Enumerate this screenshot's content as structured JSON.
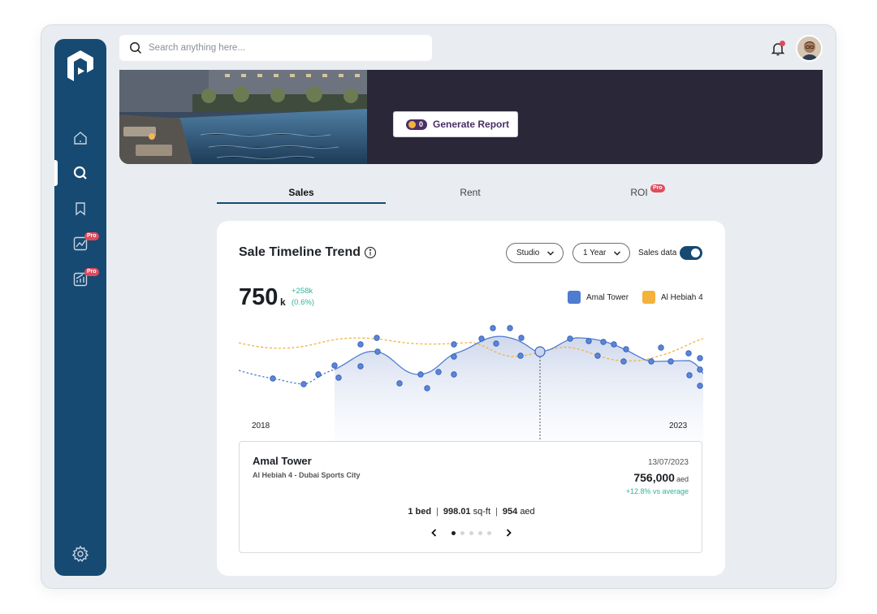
{
  "search": {
    "placeholder": "Search anything here..."
  },
  "sidebar": {
    "items": [
      {
        "icon": "home-icon"
      },
      {
        "icon": "search-icon",
        "active": true
      },
      {
        "icon": "bookmark-icon"
      },
      {
        "icon": "trend-chart-icon",
        "badge": "Pro"
      },
      {
        "icon": "growth-chart-icon",
        "badge": "Pro"
      }
    ],
    "settings_icon": "gear-icon"
  },
  "header": {
    "notification_count": "1"
  },
  "hero": {
    "credits": "0",
    "generate_label": "Generate Report"
  },
  "tabs": [
    {
      "label": "Sales",
      "active": true
    },
    {
      "label": "Rent"
    },
    {
      "label": "ROI",
      "badge": "Pro"
    }
  ],
  "card": {
    "title": "Sale Timeline Trend",
    "filters": {
      "type": "Studio",
      "period": "1 Year",
      "toggle_label": "Sales data",
      "toggle_on": true
    },
    "summary": {
      "value": "750",
      "unit": "k",
      "delta": "+258k",
      "delta_pct": "(0.6%)"
    },
    "legend": [
      {
        "name": "Amal Tower",
        "color": "#4f7bd0"
      },
      {
        "name": "Al Hebiah 4",
        "color": "#f4b13b"
      }
    ],
    "x_start": "2018",
    "x_end": "2023"
  },
  "chart_data": {
    "type": "line",
    "xlabel": "",
    "ylabel": "",
    "x_range": [
      "2018",
      "2023"
    ],
    "series": [
      {
        "name": "Amal Tower",
        "color": "#4f7bd0"
      },
      {
        "name": "Al Hebiah 4",
        "color": "#f4b13b"
      }
    ]
  },
  "detail": {
    "name": "Amal Tower",
    "location": "Al Hebiah 4 - Dubai Sports City",
    "date": "13/07/2023",
    "price": "756,000",
    "currency": "aed",
    "vs_avg": "+12.8% vs average",
    "beds": "1 bed",
    "area": "998.01",
    "area_unit": "sq-ft",
    "ppsf": "954",
    "ppsf_unit": "aed",
    "page": 1,
    "pages": 5
  }
}
